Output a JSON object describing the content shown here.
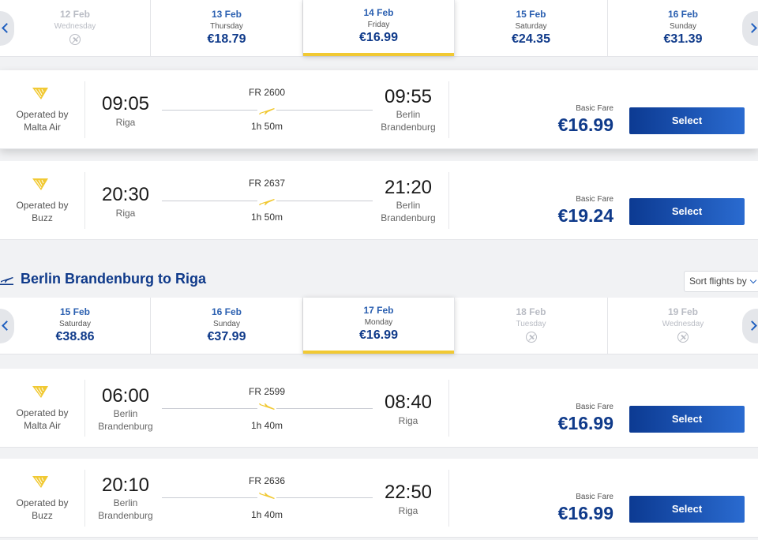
{
  "carousel_outbound": [
    {
      "date": "12 Feb",
      "day": "Wednesday",
      "price": "",
      "disabled": true
    },
    {
      "date": "13 Feb",
      "day": "Thursday",
      "price": "€18.79"
    },
    {
      "date": "14 Feb",
      "day": "Friday",
      "price": "€16.99",
      "selected": true
    },
    {
      "date": "15 Feb",
      "day": "Saturday",
      "price": "€24.35"
    },
    {
      "date": "16 Feb",
      "day": "Sunday",
      "price": "€31.39"
    }
  ],
  "flights_outbound": [
    {
      "operator_label": "Operated by",
      "operator": "Malta Air",
      "dep_time": "09:05",
      "dep_place": "Riga",
      "flight_no": "FR 2600",
      "duration": "1h 50m",
      "arr_time": "09:55",
      "arr_place_1": "Berlin",
      "arr_place_2": "Brandenburg",
      "fare_label": "Basic Fare",
      "price": "€16.99",
      "select_label": "Select"
    },
    {
      "operator_label": "Operated by",
      "operator": "Buzz",
      "dep_time": "20:30",
      "dep_place": "Riga",
      "flight_no": "FR 2637",
      "duration": "1h 50m",
      "arr_time": "21:20",
      "arr_place_1": "Berlin",
      "arr_place_2": "Brandenburg",
      "fare_label": "Basic Fare",
      "price": "€19.24",
      "select_label": "Select"
    }
  ],
  "return_section": {
    "title": "Berlin Brandenburg to Riga",
    "sort_label": "Sort flights by"
  },
  "carousel_return": [
    {
      "date": "15 Feb",
      "day": "Saturday",
      "price": "€38.86"
    },
    {
      "date": "16 Feb",
      "day": "Sunday",
      "price": "€37.99"
    },
    {
      "date": "17 Feb",
      "day": "Monday",
      "price": "€16.99",
      "selected": true
    },
    {
      "date": "18 Feb",
      "day": "Tuesday",
      "price": "",
      "disabled": true
    },
    {
      "date": "19 Feb",
      "day": "Wednesday",
      "price": "",
      "disabled": true
    }
  ],
  "flights_return": [
    {
      "operator_label": "Operated by",
      "operator": "Malta Air",
      "dep_time": "06:00",
      "dep_place_1": "Berlin",
      "dep_place_2": "Brandenburg",
      "flight_no": "FR 2599",
      "duration": "1h 40m",
      "arr_time": "08:40",
      "arr_place": "Riga",
      "fare_label": "Basic Fare",
      "price": "€16.99",
      "select_label": "Select"
    },
    {
      "operator_label": "Operated by",
      "operator": "Buzz",
      "dep_time": "20:10",
      "dep_place_1": "Berlin",
      "dep_place_2": "Brandenburg",
      "flight_no": "FR 2636",
      "duration": "1h 40m",
      "arr_time": "22:50",
      "arr_place": "Riga",
      "fare_label": "Basic Fare",
      "price": "€16.99",
      "select_label": "Select"
    }
  ],
  "colors": {
    "accent_yellow": "#f1c933",
    "brand_blue": "#0f3a8a",
    "button_blue": "#0c3a92"
  }
}
